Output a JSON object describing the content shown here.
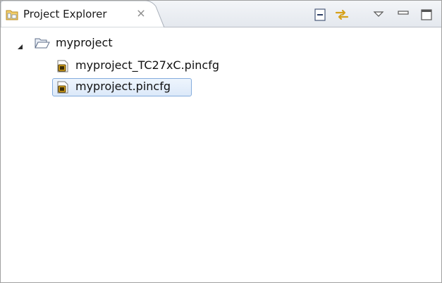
{
  "view": {
    "tab_title": "Project Explorer",
    "tab_icon": "project-explorer-icon",
    "close_icon": "close-icon",
    "toolbar": [
      {
        "name": "collapse-all-icon"
      },
      {
        "name": "link-with-editor-icon"
      },
      {
        "name": "view-menu-chevron-down-icon"
      },
      {
        "name": "minimize-icon"
      },
      {
        "name": "maximize-icon"
      }
    ]
  },
  "tree": {
    "root": {
      "label": "myproject",
      "expanded": true,
      "icon": "folder-open-icon"
    },
    "children": [
      {
        "label": "myproject_TC27xC.pincfg",
        "icon": "pincfg-file-icon",
        "selected": false
      },
      {
        "label": "myproject.pincfg",
        "icon": "pincfg-file-icon",
        "selected": true
      }
    ]
  },
  "colors": {
    "selection_border": "#84acdd",
    "selection_fill": "#dce9f9",
    "accent": "#d6a11a"
  }
}
